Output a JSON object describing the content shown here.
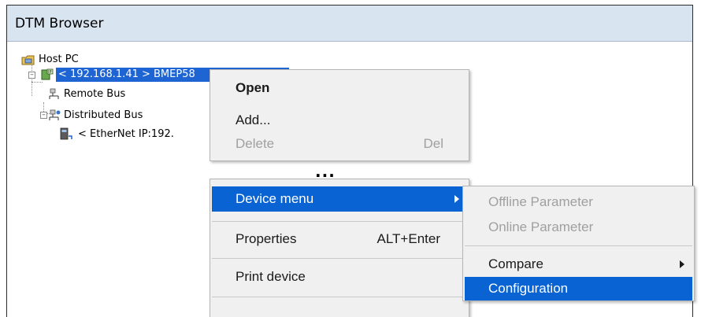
{
  "window": {
    "title": "DTM Browser"
  },
  "tree": {
    "host": "Host PC",
    "controller": "< 192.168.1.41 > BMEP58",
    "remote_bus": "Remote Bus",
    "distributed_bus": "Distributed Bus",
    "ethernet_device": "< EtherNet IP:192."
  },
  "context_menu_1": {
    "items": [
      {
        "label": "Open",
        "bold": true
      },
      {
        "label": "Add..."
      },
      {
        "label": "Delete",
        "shortcut": "Del",
        "disabled": true
      }
    ]
  },
  "ellipsis": "...",
  "context_menu_2": {
    "items": [
      {
        "label": "Device menu",
        "highlighted": true,
        "submenu": true
      },
      {
        "label": "Properties",
        "shortcut": "ALT+Enter"
      },
      {
        "label": "Print device"
      }
    ]
  },
  "submenu": {
    "items": [
      {
        "label": "Offline Parameter",
        "disabled": true
      },
      {
        "label": "Online Parameter",
        "disabled": true
      },
      {
        "label": "Compare",
        "submenu": true
      },
      {
        "label": "Configuration",
        "highlighted": true
      }
    ]
  },
  "colors": {
    "selection": "#1e64d2",
    "menu_highlight": "#0a63d3",
    "titlebar": "#d9e4f1"
  }
}
